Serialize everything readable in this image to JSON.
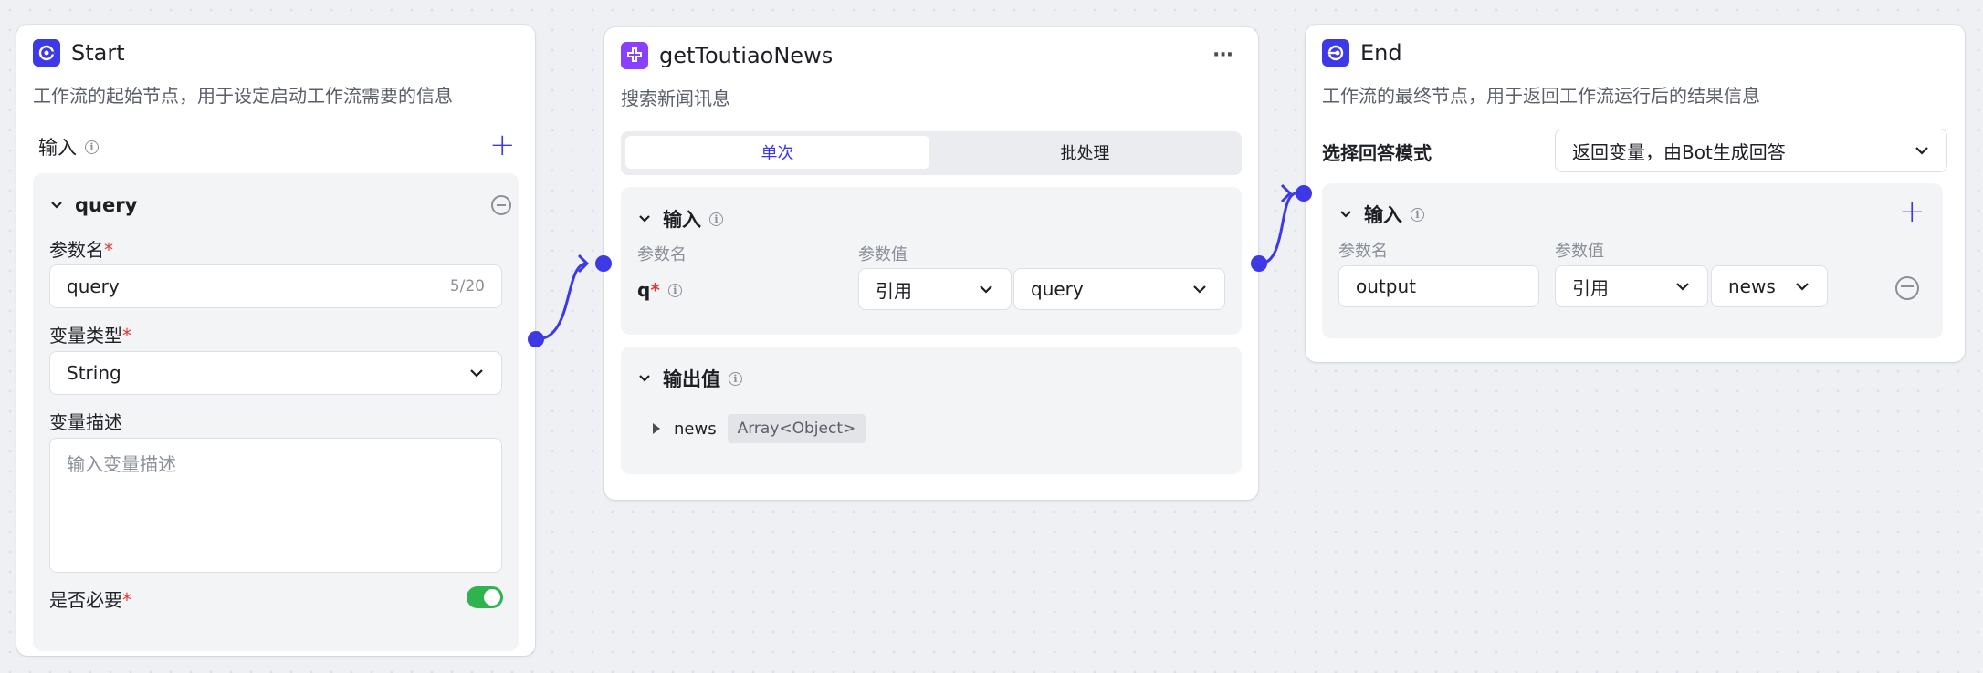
{
  "start_node": {
    "title": "Start",
    "description": "工作流的起始节点，用于设定启动工作流需要的信息",
    "input_label": "输入",
    "param": {
      "name": "query",
      "param_name_label": "参数名",
      "param_name_value": "query",
      "param_name_count": "5/20",
      "type_label": "变量类型",
      "type_value": "String",
      "desc_label": "变量描述",
      "desc_placeholder": "输入变量描述",
      "required_label": "是否必要",
      "required": true
    }
  },
  "plugin_node": {
    "title": "getToutiaoNews",
    "description": "搜索新闻讯息",
    "more_label": "···",
    "tabs": [
      "单次",
      "批处理"
    ],
    "active_tab": "单次",
    "input_label": "输入",
    "col_param_name": "参数名",
    "col_param_value": "参数值",
    "param_q_name": "q",
    "ref_type": "引用",
    "ref_value": "query",
    "output_label": "输出值",
    "output_name": "news",
    "output_type": "Array<Object>"
  },
  "end_node": {
    "title": "End",
    "description": "工作流的最终节点，用于返回工作流运行后的结果信息",
    "answer_mode_label": "选择回答模式",
    "answer_mode_value": "返回变量，由Bot生成回答",
    "input_label": "输入",
    "col_param_name": "参数名",
    "col_param_value": "参数值",
    "output_name": "output",
    "ref_type": "引用",
    "ref_value": "news"
  },
  "colors": {
    "accent": "#3e39e6",
    "start_icon": "#3e39e6",
    "plugin_icon": "#8a3ffc",
    "end_icon": "#3e39e6",
    "toggle_on": "#2fb34e",
    "required": "#e5362d"
  },
  "icons": {
    "start": "start-node-icon",
    "plugin": "plugin-node-icon",
    "end": "end-node-icon"
  }
}
